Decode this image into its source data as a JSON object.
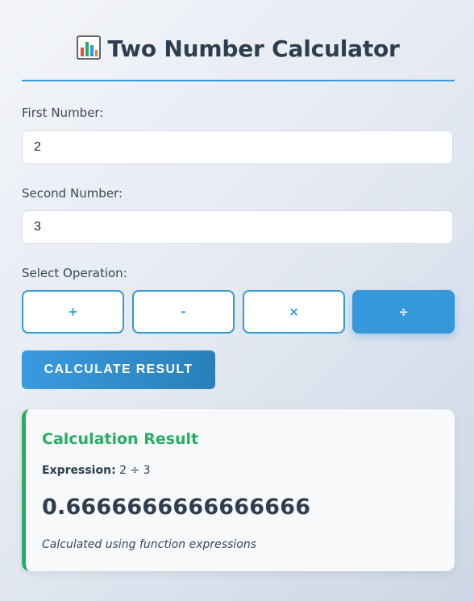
{
  "header": {
    "icon": "bar-chart-icon",
    "title": "Two Number Calculator"
  },
  "form": {
    "first_label": "First Number:",
    "first_value": "2",
    "second_label": "Second Number:",
    "second_value": "3",
    "operation_label": "Select Operation:",
    "operations": [
      {
        "symbol": "+",
        "active": false
      },
      {
        "symbol": "-",
        "active": false
      },
      {
        "symbol": "×",
        "active": false
      },
      {
        "symbol": "÷",
        "active": true
      }
    ],
    "calculate_label": "CALCULATE RESULT"
  },
  "result": {
    "title": "Calculation Result",
    "expression_label": "Expression:",
    "expression_value": "2 ÷ 3",
    "value": "0.6666666666666666",
    "note": "Calculated using function expressions"
  },
  "colors": {
    "accent": "#3498db",
    "success": "#27ae60",
    "text": "#2c3e50"
  }
}
